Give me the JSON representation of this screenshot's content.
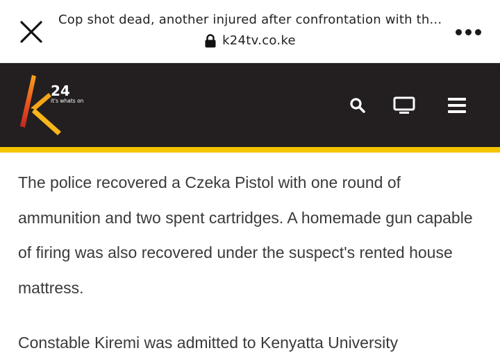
{
  "browser": {
    "page_title": "Cop shot dead, another injured after confrontation with th...",
    "url": "k24tv.co.ke",
    "close_icon": "close-icon",
    "lock_icon": "lock-icon",
    "more_icon": "more-horizontal-icon"
  },
  "site": {
    "logo_text": "24",
    "tagline": "it's whats on",
    "accent_color": "#f5c400",
    "header_color": "#231f20",
    "nav": [
      {
        "icon": "search-icon"
      },
      {
        "icon": "tv-icon"
      },
      {
        "icon": "menu-icon"
      }
    ]
  },
  "article": {
    "paragraphs": [
      "The police recovered a Czeka Pistol with one round of ammunition and two spent cartridges. A homemade gun capable of firing was also recovered under the suspect's rented house mattress.",
      "Constable Kiremi was admitted to Kenyatta University"
    ]
  }
}
